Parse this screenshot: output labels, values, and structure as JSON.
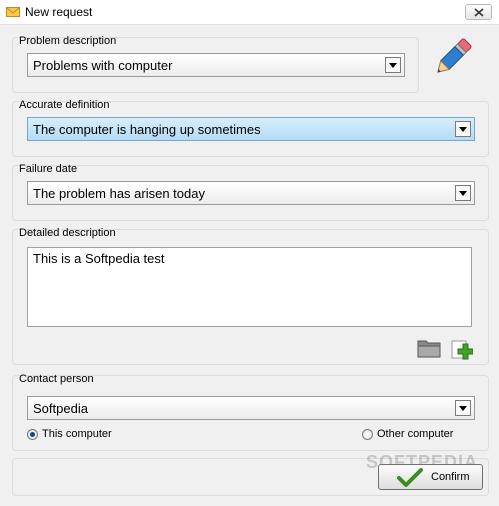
{
  "window": {
    "title": "New request"
  },
  "problem": {
    "label": "Problem description",
    "value": "Problems with computer"
  },
  "accurate": {
    "label": "Accurate definition",
    "value": "The computer is hanging up sometimes"
  },
  "failure": {
    "label": "Failure date",
    "value": "The problem has arisen today"
  },
  "details": {
    "label": "Detailed description",
    "value": "This is a Softpedia test"
  },
  "contact": {
    "label": "Contact person",
    "value": "Softpedia",
    "option_this": "This computer",
    "option_other": "Other computer"
  },
  "footer": {
    "confirm_label": "Confirm",
    "watermark": "SOFTPEDIA"
  },
  "colors": {
    "focus_highlight": "#b5dbf5",
    "confirm_check": "#3a8e1f",
    "add_icon": "#3fa32a"
  }
}
